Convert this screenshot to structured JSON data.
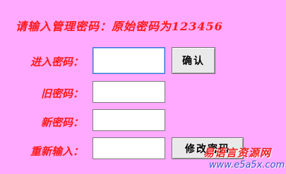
{
  "instruction": "请输入管理密码：原始密码为123456",
  "rows": [
    {
      "label": "进入密码：",
      "value": ""
    },
    {
      "label": "旧密码：",
      "value": ""
    },
    {
      "label": "新密码：",
      "value": ""
    },
    {
      "label": "重新输入：",
      "value": ""
    }
  ],
  "buttons": {
    "confirm": "确认",
    "change": "修改密码"
  },
  "watermark": {
    "site_name": "易语言资源网",
    "url": "www.e5a5x.com"
  },
  "colors": {
    "background": "#ffaaff",
    "label_text": "#ff1a1a"
  }
}
